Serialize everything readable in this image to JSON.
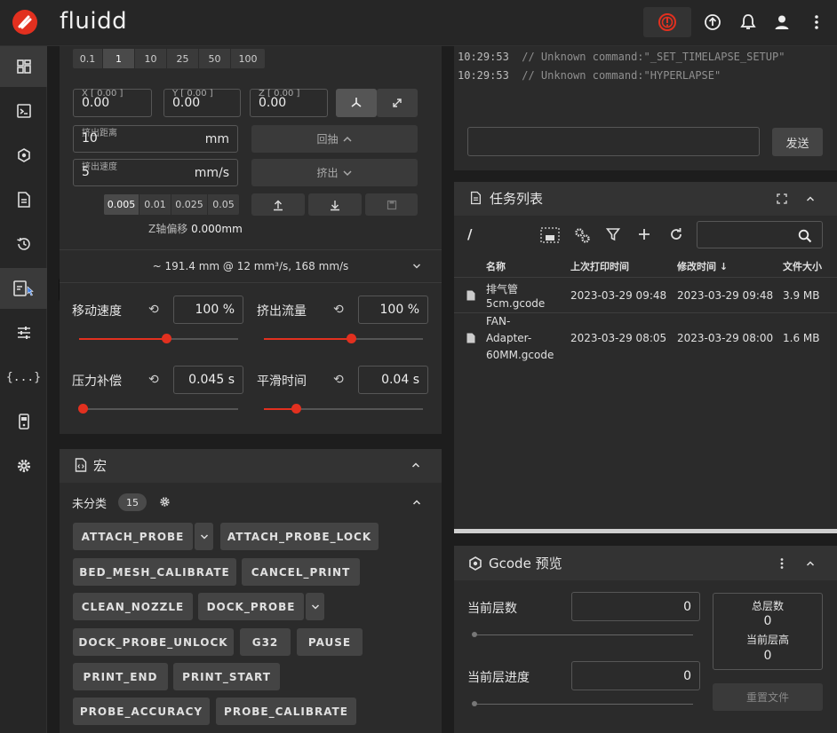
{
  "app": {
    "name": "fluidd"
  },
  "sidebar": {
    "tooltip": "延时"
  },
  "toolhead": {
    "steps": [
      "0.1",
      "1",
      "10",
      "25",
      "50",
      "100"
    ],
    "pos": {
      "x_label": "X [ 0.00 ]",
      "x_val": "0.00",
      "y_label": "Y [ 0.00 ]",
      "y_val": "0.00",
      "z_label": "Z [ 0.00 ]",
      "z_val": "0.00"
    },
    "extrude_len_label": "挤出距离",
    "extrude_len": "10",
    "extrude_len_unit": "mm",
    "extrude_speed_label": "挤出速度",
    "extrude_speed": "5",
    "extrude_speed_unit": "mm/s",
    "retract_label": "回抽",
    "extrude_label": "挤出",
    "z_steps": [
      "0.005",
      "0.01",
      "0.025",
      "0.05"
    ],
    "z_offset_label": "Z轴偏移",
    "z_offset_value": "0.000mm",
    "flow_summary": "~ 191.4 mm @ 12 mm³/s, 168 mm/s",
    "speed_label": "移动速度",
    "speed_value": "100 %",
    "speed_level": 0.55,
    "flow_label": "挤出流量",
    "flow_value": "100 %",
    "flow_level": 0.55,
    "pa_label": "压力补偿",
    "pa_value": "0.045 s",
    "pa_level": 0.02,
    "smooth_label": "平滑时间",
    "smooth_value": "0.04 s",
    "smooth_level": 0.2
  },
  "macros": {
    "title": "宏",
    "category": "未分类",
    "count": "15",
    "items": [
      "ATTACH_PROBE",
      "ATTACH_PROBE_LOCK",
      "BED_MESH_CALIBRATE",
      "CANCEL_PRINT",
      "CLEAN_NOZZLE",
      "DOCK_PROBE",
      "DOCK_PROBE_UNLOCK",
      "G32",
      "PAUSE",
      "PRINT_END",
      "PRINT_START",
      "PROBE_ACCURACY",
      "PROBE_CALIBRATE"
    ]
  },
  "console": {
    "lines": [
      {
        "time": "10:29:53",
        "text": "// Unknown command:\"_SET_TIMELAPSE_SETUP\""
      },
      {
        "time": "10:29:53",
        "text": "// Unknown command:\"HYPERLAPSE\""
      }
    ],
    "send_label": "发送"
  },
  "jobs": {
    "title": "任务列表",
    "path": "/",
    "columns": [
      "名称",
      "上次打印时间",
      "修改时间",
      "文件大小"
    ],
    "rows": [
      {
        "name1": "排气管",
        "name2": "5cm.gcode",
        "name3": "",
        "printed": "2023-03-29 09:48",
        "modified": "2023-03-29 09:48",
        "size": "3.9 MB"
      },
      {
        "name1": "FAN-",
        "name2": "Adapter-",
        "name3": "60MM.gcode",
        "printed": "2023-03-29 08:05",
        "modified": "2023-03-29 08:00",
        "size": "1.6 MB"
      }
    ]
  },
  "gcode_preview": {
    "title": "Gcode 预览",
    "current_layer_label": "当前层数",
    "current_layer": "0",
    "layer_progress_label": "当前层进度",
    "layer_progress": "0",
    "total_layers_label": "总层数",
    "total_layers": "0",
    "layer_height_label": "当前层高",
    "layer_height": "0",
    "reset_label": "重置文件"
  }
}
